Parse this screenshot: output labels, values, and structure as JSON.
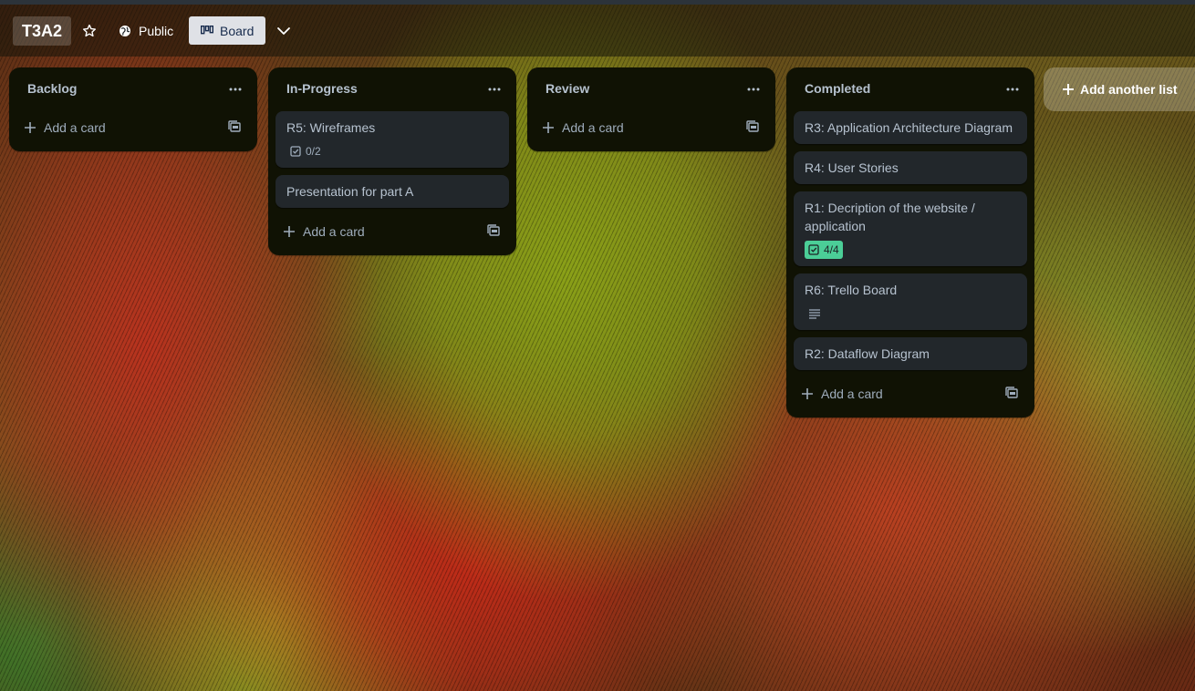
{
  "board": {
    "title": "T3A2",
    "visibility": "Public",
    "view": "Board"
  },
  "lists": [
    {
      "title": "Backlog",
      "add_label": "Add a card",
      "cards": []
    },
    {
      "title": "In-Progress",
      "add_label": "Add a card",
      "cards": [
        {
          "title": "R5: Wireframes",
          "checklist": "0/2"
        },
        {
          "title": "Presentation for part A"
        }
      ]
    },
    {
      "title": "Review",
      "add_label": "Add a card",
      "cards": []
    },
    {
      "title": "Completed",
      "add_label": "Add a card",
      "cards": [
        {
          "title": "R3: Application Architecture Diagram"
        },
        {
          "title": "R4: User Stories"
        },
        {
          "title": "R1: Decription of the website / application",
          "checklist": "4/4"
        },
        {
          "title": "R6: Trello Board"
        },
        {
          "title": "R2: Dataflow Diagram"
        }
      ]
    }
  ],
  "add_list_label": "Add another list",
  "colors": {
    "list_bg": "#101204",
    "card_bg": "#22272b",
    "complete_badge": "#4bce97",
    "board_button_bg": "#dfe1e6"
  },
  "icons": {
    "star": "star-icon",
    "visibility": "globe-icon",
    "board_view": "board-view-icon",
    "chevron": "chevron-down-icon",
    "list_menu": "ellipsis-icon",
    "add": "plus-icon",
    "template": "card-template-icon",
    "checklist": "checklist-icon",
    "description": "description-icon"
  }
}
